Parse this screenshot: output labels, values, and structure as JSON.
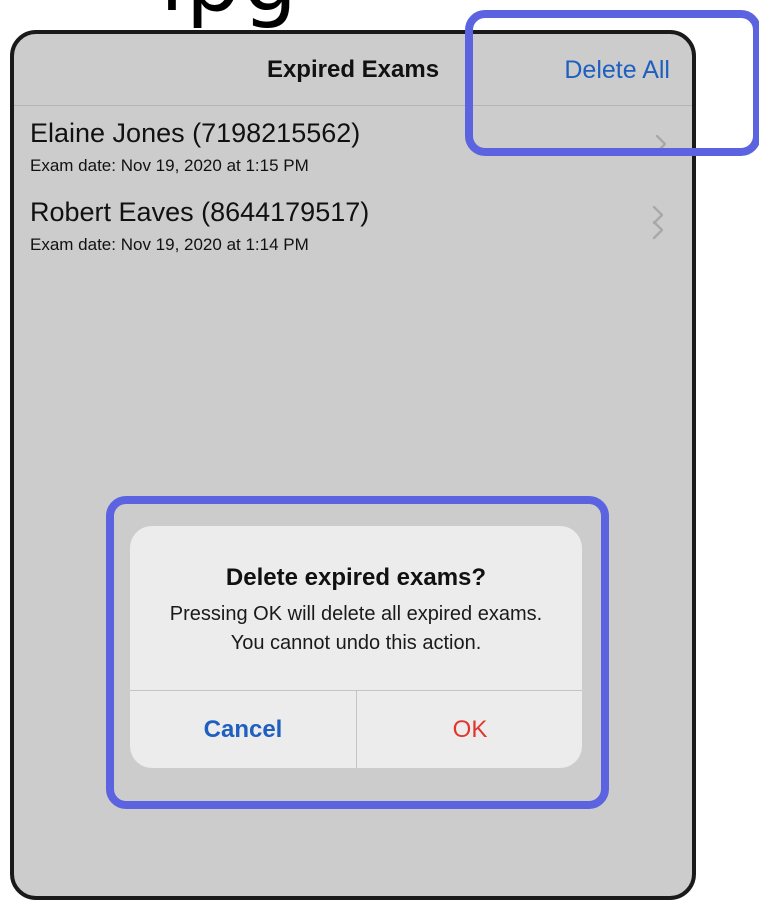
{
  "top_fragment": "ipg",
  "navbar": {
    "title": "Expired Exams",
    "action_label": "Delete All"
  },
  "exams": [
    {
      "name": "Elaine Jones (7198215562)",
      "date": "Exam date: Nov 19, 2020 at 1:15 PM"
    },
    {
      "name": "Robert Eaves (8644179517)",
      "date": "Exam date: Nov 19, 2020 at 1:14 PM"
    }
  ],
  "alert": {
    "title": "Delete expired exams?",
    "message": "Pressing OK will delete all expired exams. You cannot undo this action.",
    "cancel_label": "Cancel",
    "ok_label": "OK"
  },
  "icons": {
    "row_chevron": "chevron-right-icon"
  },
  "colors": {
    "accent": "#1f5fbf",
    "destructive": "#e0362e",
    "highlight": "#5b63e0",
    "dimmed_background": "#cccccc"
  }
}
